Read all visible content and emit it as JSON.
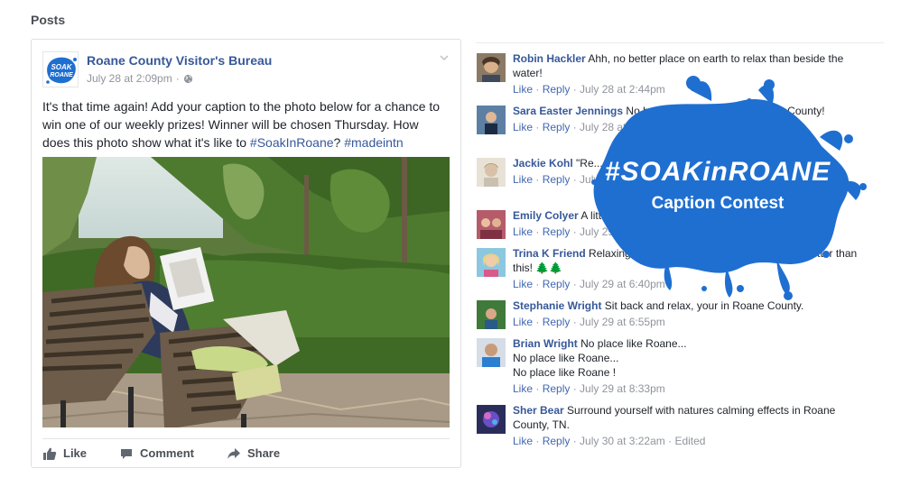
{
  "section": {
    "title": "Posts"
  },
  "post": {
    "page_name": "Roane County Visitor's Bureau",
    "timestamp": "July 28 at 2:09pm",
    "separator": "·",
    "logo_text_top": "SOAK",
    "logo_text_bottom": "ROANE",
    "text_main": "It's that time again! Add your caption to the photo below for a chance to win one of our weekly prizes! Winner will be chosen Thursday. How does this photo show what it's like to ",
    "hashtag_1": "#SoakInRoane",
    "text_mid": "? ",
    "hashtag_2": "#madeintn",
    "actions": {
      "like": "Like",
      "comment": "Comment",
      "share": "Share"
    }
  },
  "comments": [
    {
      "author": "Robin Hackler",
      "text": "Ahh, no better place on earth to relax than beside the water!",
      "like": "Like",
      "reply": "Reply",
      "time": "July 28 at 2:44pm",
      "edited": ""
    },
    {
      "author": "Sara Easter Jennings",
      "text": "No better pl... dive in than Roane County!",
      "like": "Like",
      "reply": "Reply",
      "time": "July 28 at 4...",
      "edited": ""
    },
    {
      "author": "Jackie Kohl",
      "text": "\"Re... get any better than this.\"",
      "like": "Like",
      "reply": "Reply",
      "time": "July...",
      "edited": ""
    },
    {
      "author": "Emily Colyer",
      "text": "A little...",
      "like": "Like",
      "reply": "Reply",
      "time": "July 29 at 4...",
      "edited": ""
    },
    {
      "author": "Trina K Friend",
      "text": "Relaxing in Roane... Roane. Doesn't get any better than this! 🌲🌲",
      "like": "Like",
      "reply": "Reply",
      "time": "July 29 at 6:40pm",
      "edited": ""
    },
    {
      "author": "Stephanie Wright",
      "text": "Sit back and relax, your in Roane County.",
      "like": "Like",
      "reply": "Reply",
      "time": "July 29 at 6:55pm",
      "edited": ""
    },
    {
      "author": "Brian Wright",
      "text": "No place like Roane...",
      "text2": "No place like Roane...",
      "text3": "No place like Roane !",
      "like": "Like",
      "reply": "Reply",
      "time": "July 29 at 8:33pm",
      "edited": ""
    },
    {
      "author": "Sher Bear",
      "text": "Surround yourself with natures calming effects in Roane County, TN.",
      "like": "Like",
      "reply": "Reply",
      "time": "July 30 at 3:22am",
      "edited": "Edited"
    }
  ],
  "overlay": {
    "hashtag": "#SOAKinROANE",
    "subtitle": "Caption Contest",
    "color": "#1f6fd1"
  }
}
